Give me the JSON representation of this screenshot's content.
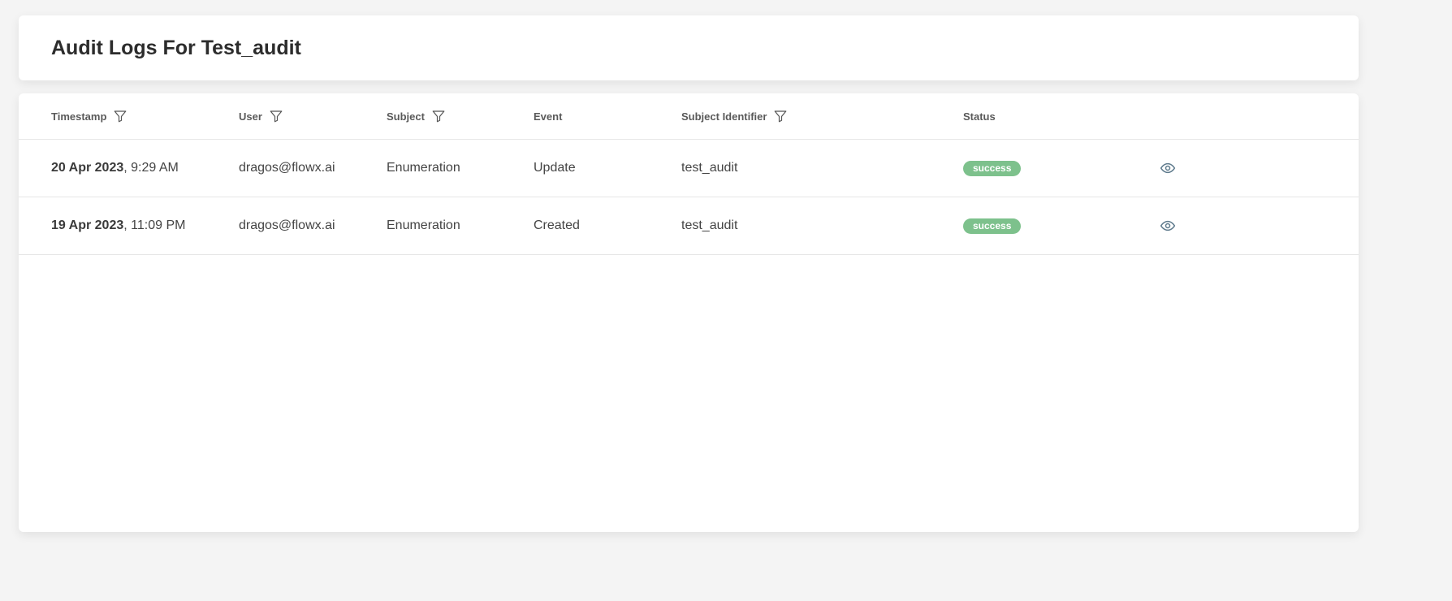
{
  "header": {
    "title": "Audit Logs For Test_audit"
  },
  "table": {
    "columns": {
      "timestamp": "Timestamp",
      "user": "User",
      "subject": "Subject",
      "event": "Event",
      "subject_identifier": "Subject Identifier",
      "status": "Status"
    },
    "rows": [
      {
        "date": "20 Apr 2023",
        "time": ", 9:29 AM",
        "user": "dragos@flowx.ai",
        "subject": "Enumeration",
        "event": "Update",
        "subject_identifier": "test_audit",
        "status": "success"
      },
      {
        "date": "19 Apr 2023",
        "time": ", 11:09 PM",
        "user": "dragos@flowx.ai",
        "subject": "Enumeration",
        "event": "Created",
        "subject_identifier": "test_audit",
        "status": "success"
      }
    ]
  },
  "icons": {
    "filter": "filter-icon",
    "view": "eye-icon"
  },
  "colors": {
    "status_success": "#7dc18c",
    "background": "#f4f4f4"
  }
}
